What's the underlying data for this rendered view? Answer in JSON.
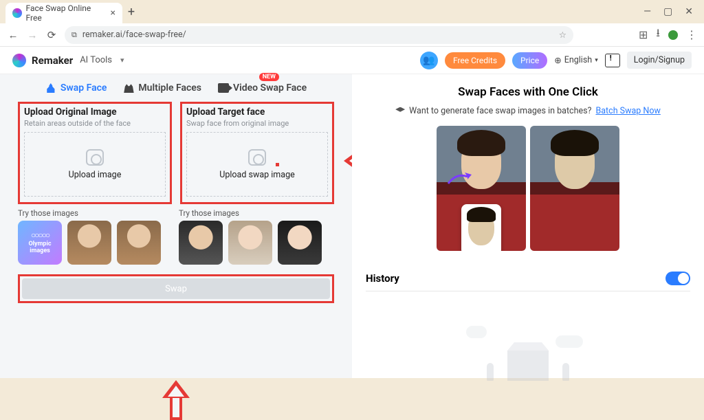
{
  "browser": {
    "tab_title": "Face Swap Online Free",
    "address_prefix_icon": "secure",
    "address": "remaker.ai/face-swap-free/"
  },
  "header": {
    "brand": "Remaker",
    "ai_tools_label": "AI Tools",
    "free_credits_label": "Free Credits",
    "price_label": "Price",
    "language": "English",
    "login_label": "Login/Signup"
  },
  "tabs": {
    "swap_face": "Swap Face",
    "multiple_faces": "Multiple Faces",
    "video_swap_face": "Video Swap Face",
    "new_badge": "NEW"
  },
  "upload": {
    "original": {
      "title": "Upload Original Image",
      "subtitle": "Retain areas outside of the face",
      "drop_label": "Upload image",
      "try_label": "Try those images",
      "olympic_label": "Olympic images"
    },
    "target": {
      "title": "Upload Target face",
      "subtitle": "Swap face from original image",
      "drop_label": "Upload swap image",
      "try_label": "Try those images"
    },
    "swap_button": "Swap"
  },
  "right": {
    "title": "Swap Faces with One Click",
    "batch_question": "Want to generate face swap images in batches?",
    "batch_link": "Batch Swap Now",
    "history_label": "History"
  }
}
